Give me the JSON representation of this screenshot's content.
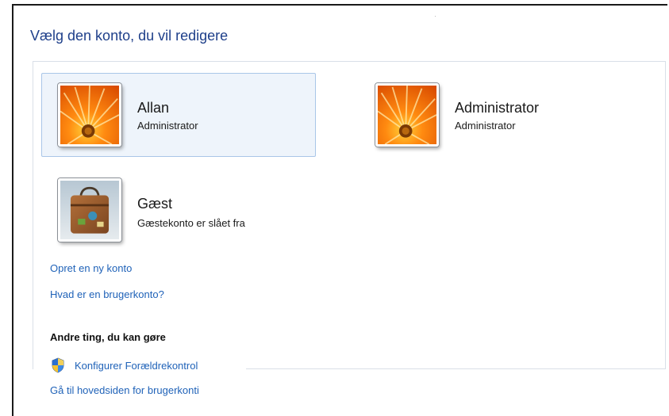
{
  "header": {
    "title": "Vælg den konto, du vil redigere"
  },
  "accounts": [
    {
      "name": "Allan",
      "role": "Administrator",
      "picture": "orange-flower"
    },
    {
      "name": "Administrator",
      "role": "Administrator",
      "picture": "orange-flower"
    },
    {
      "name": "Gæst",
      "role": "Gæstekonto er slået fra",
      "picture": "suitcase"
    }
  ],
  "links": {
    "create_account": "Opret en ny konto",
    "what_is_account": "Hvad er en brugerkonto?"
  },
  "other": {
    "heading": "Andre ting, du kan gøre",
    "parental_controls": "Konfigurer Forældrekontrol",
    "parental_controls_icon": "uac-shield-icon",
    "go_main": "Gå til hovedsiden for brugerkonti"
  },
  "colors": {
    "link": "#1f62b8",
    "title": "#1e3f8a",
    "selection": "#eef4fb"
  }
}
